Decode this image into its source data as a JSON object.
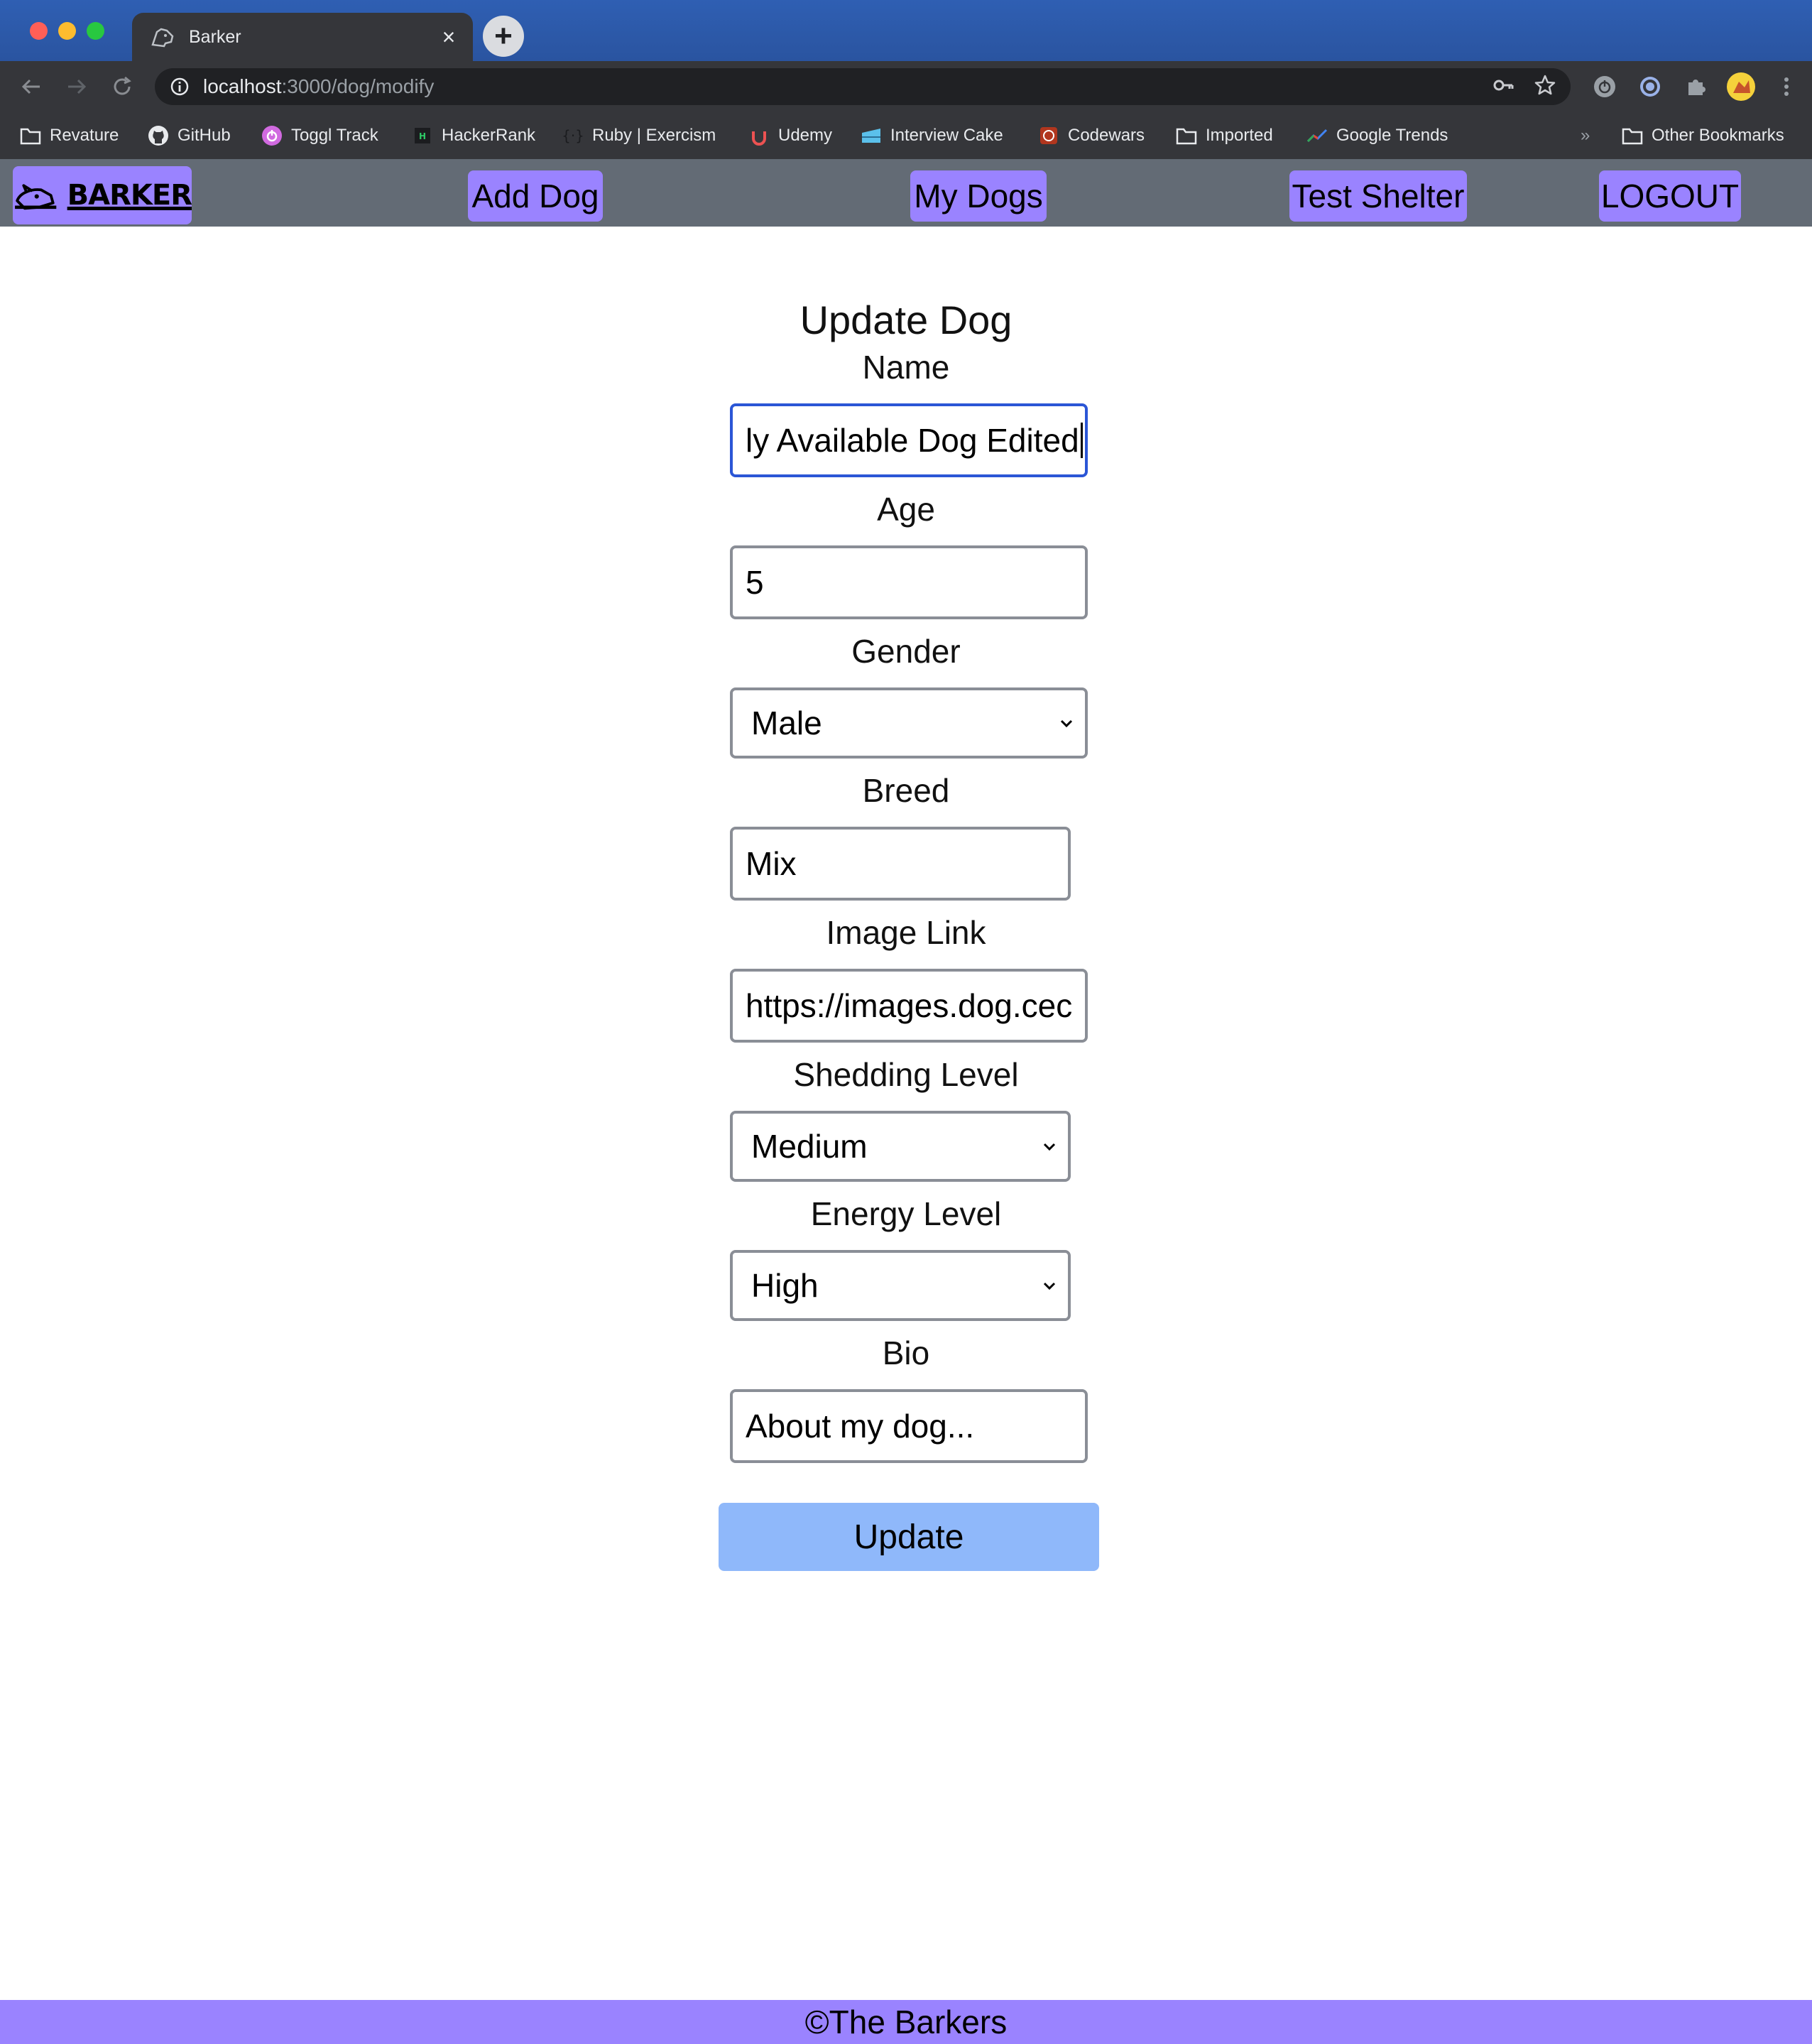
{
  "browser": {
    "tab_title": "Barker",
    "new_tab_symbol": "+",
    "close_symbol": "×",
    "url_host": "localhost",
    "url_path": ":3000/dog/modify",
    "bookmarks": [
      "Revature",
      "GitHub",
      "Toggl Track",
      "HackerRank",
      "Ruby | Exercism",
      "Udemy",
      "Interview Cake",
      "Codewars",
      "Imported",
      "Google Trends"
    ],
    "overflow_symbol": "»",
    "other_bookmarks": "Other Bookmarks"
  },
  "nav": {
    "logo_text": "BARKER",
    "items": [
      "Add Dog",
      "My Dogs",
      "Test Shelter",
      "LOGOUT"
    ],
    "accent_color": "#9a83ff",
    "bar_color": "#636b75"
  },
  "form": {
    "title": "Update Dog",
    "name_label": "Name",
    "name_value": "ly Available Dog Edited",
    "age_label": "Age",
    "age_value": "5",
    "gender_label": "Gender",
    "gender_value": "Male",
    "breed_label": "Breed",
    "breed_value": "Mix",
    "image_label": "Image Link",
    "image_value": "https://images.dog.cec",
    "shedding_label": "Shedding Level",
    "shedding_value": "Medium",
    "energy_label": "Energy Level",
    "energy_value": "High",
    "bio_label": "Bio",
    "bio_placeholder": "About my dog...",
    "submit_label": "Update",
    "submit_color": "#8fb8fa"
  },
  "footer": {
    "text": "©The Barkers"
  }
}
